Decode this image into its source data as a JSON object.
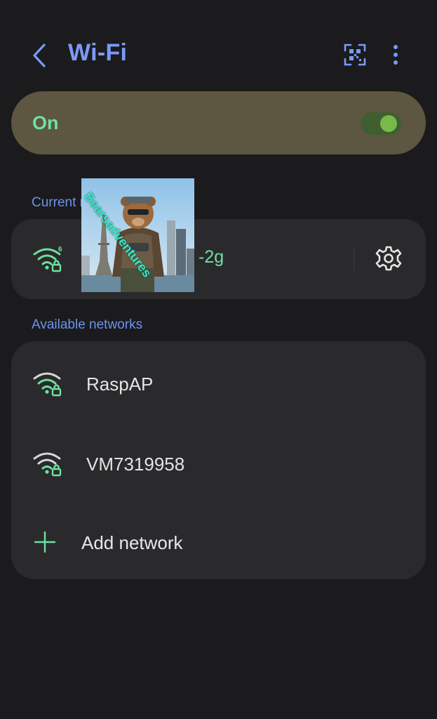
{
  "header": {
    "title": "Wi-Fi",
    "back_icon": "chevron-left-icon",
    "qr_icon": "qr-scan-icon",
    "more_icon": "more-vertical-icon"
  },
  "toggle": {
    "label": "On",
    "state": true
  },
  "current": {
    "section_label": "Current network",
    "network_name": "-2g",
    "wifi_badge": "6",
    "wifi_icon": "wifi-6-secured-icon",
    "settings_icon": "gear-icon"
  },
  "overlay_image": {
    "caption": "Bearsadventures"
  },
  "available": {
    "section_label": "Available networks",
    "networks": [
      {
        "name": "RaspAP",
        "icon": "wifi-secured-icon"
      },
      {
        "name": "VM7319958",
        "icon": "wifi-secured-icon"
      }
    ],
    "add_label": "Add network",
    "add_icon": "plus-icon"
  },
  "colors": {
    "background": "#1b1b1d",
    "card": "#2a2a2c",
    "accent_blue": "#7c99f7",
    "accent_green": "#6fe0a0",
    "toggle_card": "#5d5640"
  }
}
